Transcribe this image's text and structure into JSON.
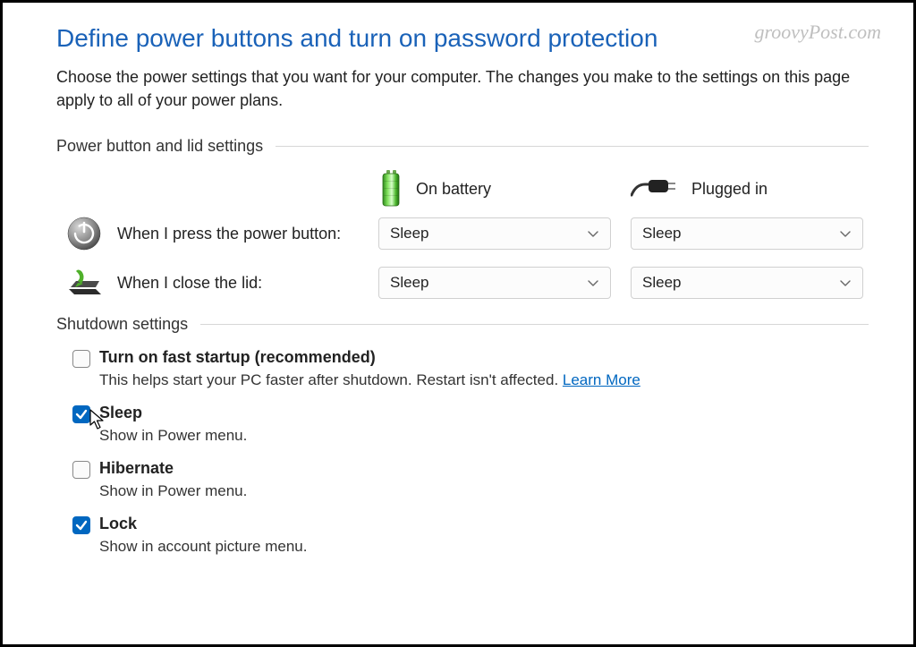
{
  "watermark": "groovyPost.com",
  "page_title": "Define power buttons and turn on password protection",
  "intro": "Choose the power settings that you want for your computer. The changes you make to the settings on this page apply to all of your power plans.",
  "section1": {
    "heading": "Power button and lid settings",
    "col_battery": "On battery",
    "col_plugged": "Plugged in",
    "rows": [
      {
        "label": "When I press the power button:",
        "battery_value": "Sleep",
        "plugged_value": "Sleep"
      },
      {
        "label": "When I close the lid:",
        "battery_value": "Sleep",
        "plugged_value": "Sleep"
      }
    ]
  },
  "section2": {
    "heading": "Shutdown settings",
    "items": [
      {
        "title": "Turn on fast startup (recommended)",
        "checked": false,
        "desc": "This helps start your PC faster after shutdown. Restart isn't affected. ",
        "link": "Learn More"
      },
      {
        "title": "Sleep",
        "checked": true,
        "desc": "Show in Power menu."
      },
      {
        "title": "Hibernate",
        "checked": false,
        "desc": "Show in Power menu."
      },
      {
        "title": "Lock",
        "checked": true,
        "desc": "Show in account picture menu."
      }
    ]
  }
}
